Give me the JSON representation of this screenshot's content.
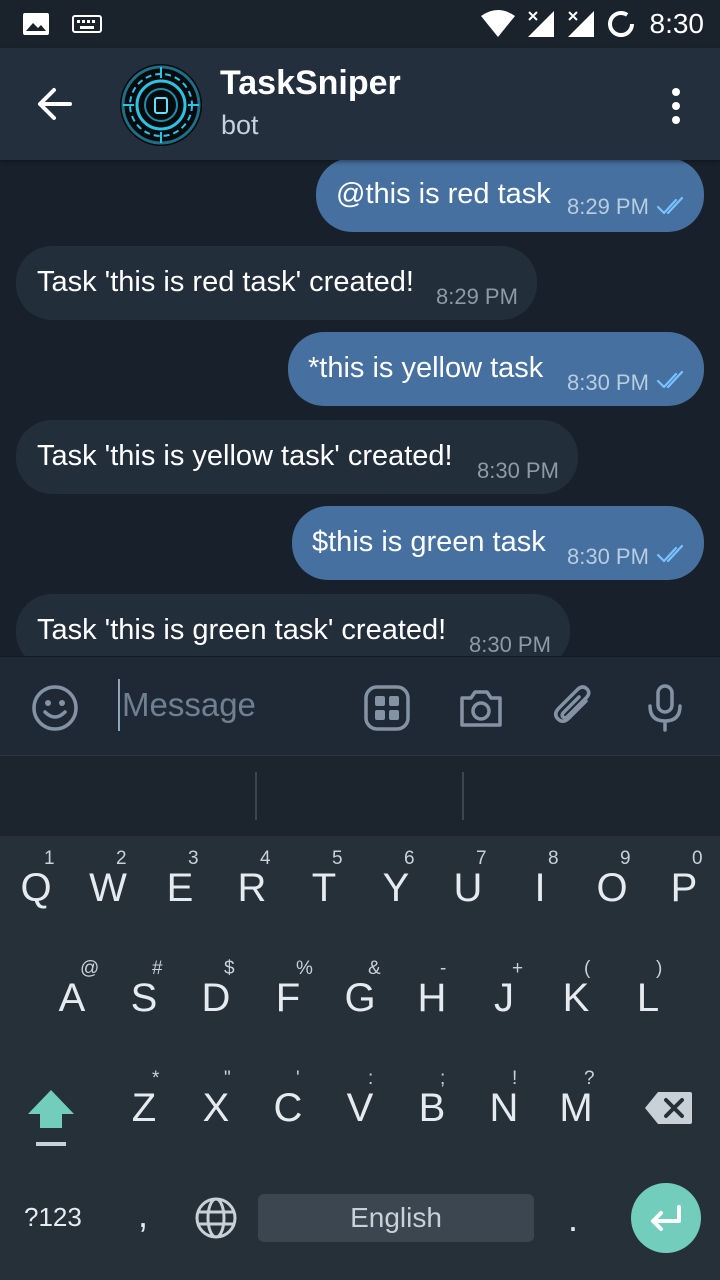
{
  "status_bar": {
    "time": "8:30",
    "icons": [
      "image-icon",
      "keyboard-icon",
      "wifi-icon",
      "signal-icon",
      "signal-icon",
      "sync-icon"
    ]
  },
  "header": {
    "title": "TaskSniper",
    "subtitle": "bot",
    "icons": [
      "back-arrow-icon",
      "bot-avatar",
      "more-vert-icon"
    ]
  },
  "messages": [
    {
      "direction": "outgoing",
      "text": "@this is red task",
      "time": "8:29 PM",
      "read": true
    },
    {
      "direction": "incoming",
      "text": "Task 'this is red task' created!",
      "time": "8:29 PM"
    },
    {
      "direction": "outgoing",
      "text": "*this is yellow task",
      "time": "8:30 PM",
      "read": true
    },
    {
      "direction": "incoming",
      "text": "Task 'this is yellow task' created!",
      "time": "8:30 PM"
    },
    {
      "direction": "outgoing",
      "text": "$this is green task",
      "time": "8:30 PM",
      "read": true
    },
    {
      "direction": "incoming",
      "text": "Task 'this is green task' created!",
      "time": "8:30 PM"
    }
  ],
  "composer": {
    "placeholder": "Message",
    "icons": [
      "emoji-icon",
      "bot-commands-icon",
      "camera-icon",
      "attach-icon",
      "mic-icon"
    ]
  },
  "keyboard": {
    "row1": [
      {
        "key": "Q",
        "hint": "1"
      },
      {
        "key": "W",
        "hint": "2"
      },
      {
        "key": "E",
        "hint": "3"
      },
      {
        "key": "R",
        "hint": "4"
      },
      {
        "key": "T",
        "hint": "5"
      },
      {
        "key": "Y",
        "hint": "6"
      },
      {
        "key": "U",
        "hint": "7"
      },
      {
        "key": "I",
        "hint": "8"
      },
      {
        "key": "O",
        "hint": "9"
      },
      {
        "key": "P",
        "hint": "0"
      }
    ],
    "row2": [
      {
        "key": "A",
        "hint": "@"
      },
      {
        "key": "S",
        "hint": "#"
      },
      {
        "key": "D",
        "hint": "$"
      },
      {
        "key": "F",
        "hint": "%"
      },
      {
        "key": "G",
        "hint": "&"
      },
      {
        "key": "H",
        "hint": "-"
      },
      {
        "key": "J",
        "hint": "+"
      },
      {
        "key": "K",
        "hint": "("
      },
      {
        "key": "L",
        "hint": ")"
      }
    ],
    "row3": [
      {
        "key": "Z",
        "hint": "*"
      },
      {
        "key": "X",
        "hint": "\""
      },
      {
        "key": "C",
        "hint": "'"
      },
      {
        "key": "V",
        "hint": ":"
      },
      {
        "key": "B",
        "hint": ";"
      },
      {
        "key": "N",
        "hint": "!"
      },
      {
        "key": "M",
        "hint": "?"
      }
    ],
    "symbols_key": "?123",
    "comma_key": ",",
    "space_label": "English",
    "period_key": ".",
    "icons": [
      "shift-icon",
      "backspace-icon",
      "globe-icon",
      "enter-icon"
    ],
    "accent_color": "#72cdbd"
  }
}
